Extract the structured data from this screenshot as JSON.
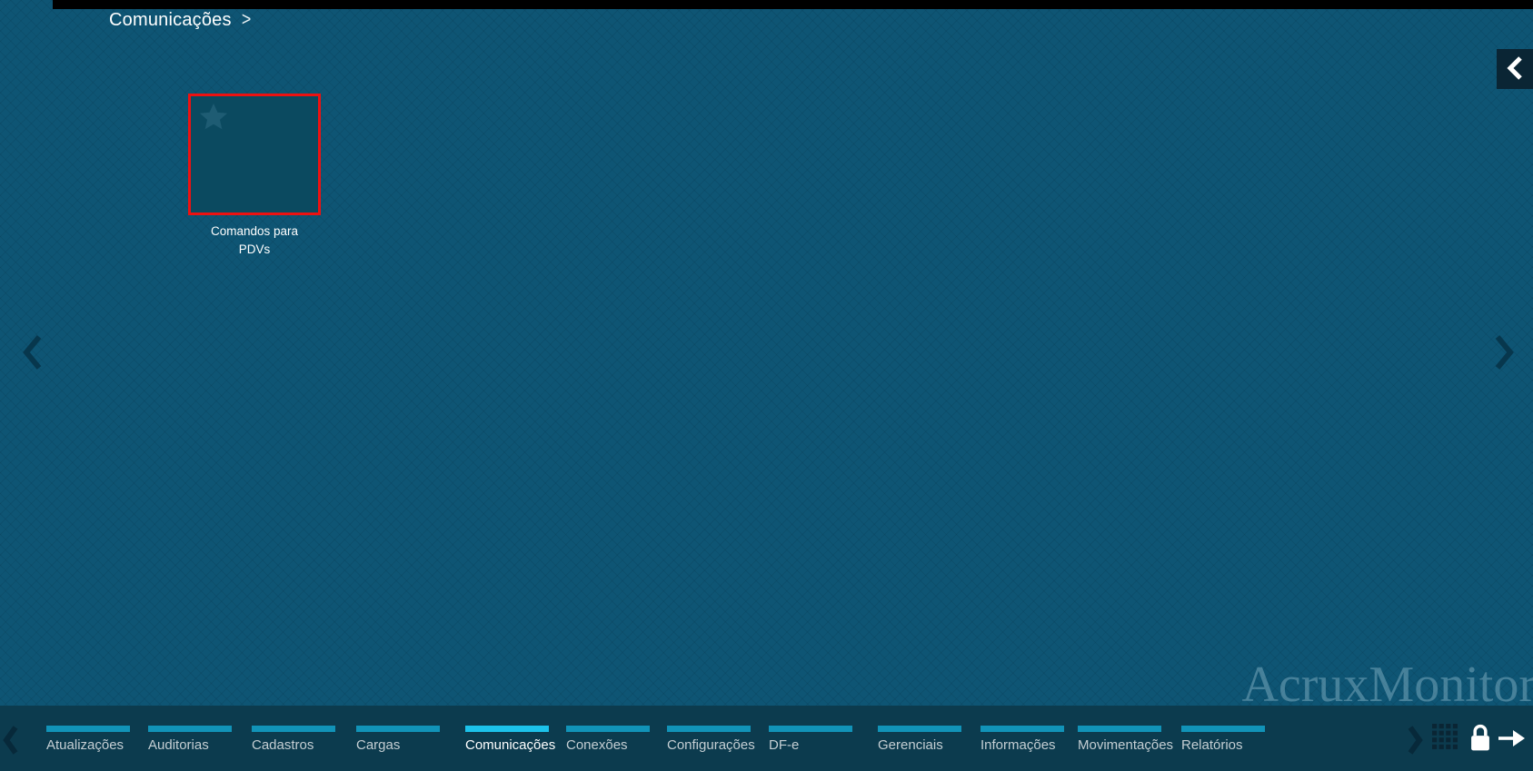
{
  "app": {
    "watermark": "AcruxMonitor"
  },
  "colors": {
    "background": "#0e5574",
    "bottom_bar": "#0c3b4e",
    "accent": "#1193b8",
    "accent_active": "#1cc2ea",
    "tile_fill": "#0b4a60",
    "tile_border_red": "#ee1111",
    "menu_text": "#c4ced3",
    "menu_text_active": "#ffffff"
  },
  "breadcrumb": {
    "label": "Comunicações",
    "separator": ">"
  },
  "content": {
    "tiles": [
      {
        "label": "Comandos para PDVs",
        "selected": true,
        "favorite_icon": "star"
      }
    ]
  },
  "icons": {
    "collapse_panel": "chevron-left",
    "page_prev": "chevron-left",
    "page_next": "chevron-right",
    "menu_scroll_left": "chevron-left",
    "menu_scroll_right": "chevron-right",
    "apps_grid": "grid",
    "lock": "padlock",
    "exit": "arrow-right"
  },
  "bottom_menu": {
    "items": [
      {
        "label": "Atualizações",
        "active": false
      },
      {
        "label": "Auditorias",
        "active": false
      },
      {
        "label": "Cadastros",
        "active": false
      },
      {
        "label": "Cargas",
        "active": false
      },
      {
        "label": "Comunicações",
        "active": true
      },
      {
        "label": "Conexões",
        "active": false
      },
      {
        "label": "Configurações",
        "active": false
      },
      {
        "label": "DF-e",
        "active": false
      },
      {
        "label": "Gerenciais",
        "active": false
      },
      {
        "label": "Informações",
        "active": false
      },
      {
        "label": "Movimentações",
        "active": false
      },
      {
        "label": "Relatórios",
        "active": false
      }
    ]
  }
}
